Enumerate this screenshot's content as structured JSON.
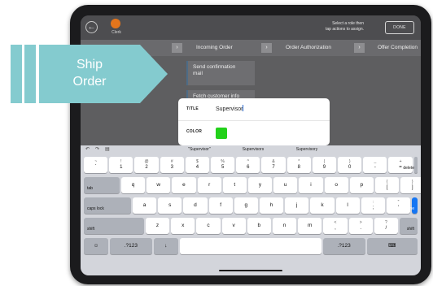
{
  "topbar": {
    "role": "Clerk",
    "hint_line1": "Select a role then",
    "hint_line2": "tap actions to assign.",
    "done_label": "DONE"
  },
  "flow": {
    "steps": [
      "Incoming Order",
      "Order Authorization",
      "Offer Completion"
    ]
  },
  "cards": [
    {
      "line1": "Send confirmation",
      "line2": "mail"
    },
    {
      "line1": "Fetch customer info",
      "line2": ""
    }
  ],
  "popup": {
    "title_label": "TITLE",
    "title_value": "Supervisor",
    "color_label": "COLOR",
    "color_value": "#22d11a"
  },
  "keyboard": {
    "suggestions": [
      "\"Supervisor\"",
      "Supervisors",
      "Supervisory"
    ],
    "number_row": [
      {
        "top": "~",
        "main": "`"
      },
      {
        "top": "!",
        "main": "1"
      },
      {
        "top": "@",
        "main": "2"
      },
      {
        "top": "#",
        "main": "3"
      },
      {
        "top": "$",
        "main": "4"
      },
      {
        "top": "%",
        "main": "5"
      },
      {
        "top": "^",
        "main": "6"
      },
      {
        "top": "&",
        "main": "7"
      },
      {
        "top": "*",
        "main": "8"
      },
      {
        "top": "(",
        "main": "9"
      },
      {
        "top": ")",
        "main": "0"
      },
      {
        "top": "_",
        "main": "-"
      },
      {
        "top": "+",
        "main": "="
      }
    ],
    "delete": "delete",
    "tab": "tab",
    "row2": [
      "q",
      "w",
      "e",
      "r",
      "t",
      "y",
      "u",
      "i",
      "o",
      "p"
    ],
    "row2_extra": [
      {
        "top": "{",
        "main": "["
      },
      {
        "top": "}",
        "main": "]"
      },
      {
        "top": "|",
        "main": "\\"
      }
    ],
    "caps": "caps lock",
    "row3": [
      "a",
      "s",
      "d",
      "f",
      "g",
      "h",
      "j",
      "k",
      "l"
    ],
    "row3_extra": [
      {
        "top": ":",
        "main": ";"
      },
      {
        "top": "\"",
        "main": "'"
      }
    ],
    "done": "done",
    "shift": "shift",
    "row4": [
      "z",
      "x",
      "c",
      "v",
      "b",
      "n",
      "m"
    ],
    "row4_extra": [
      {
        "top": "<",
        "main": ","
      },
      {
        "top": ">",
        "main": "."
      },
      {
        "top": "?",
        "main": "/"
      }
    ],
    "numbers_label": ".?123"
  },
  "ship_tag": {
    "line1": "Ship",
    "line2": "Order"
  },
  "colors": {
    "accent_blue": "#1676f3",
    "avatar_orange": "#e3751c",
    "ship_teal": "#84cbcf"
  }
}
